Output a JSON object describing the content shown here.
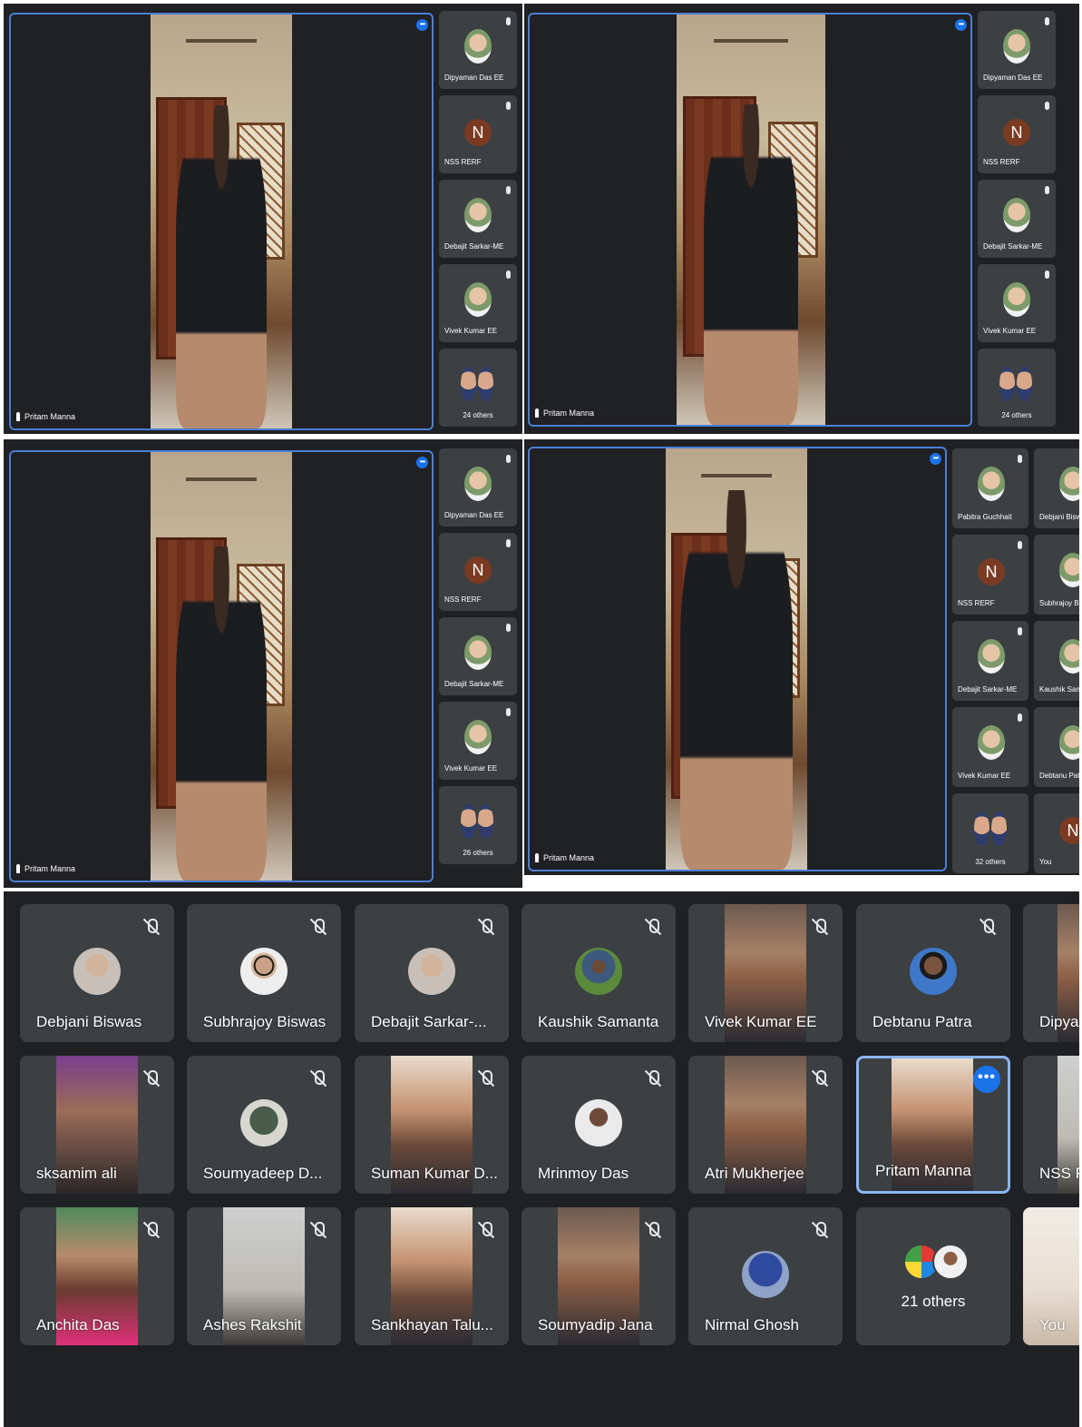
{
  "colors": {
    "meet_bg": "#202124",
    "tile_bg": "#3c4043",
    "active_border": "#4a7fd6",
    "selected_border": "#8ab4f8",
    "more_button": "#1a73e8"
  },
  "screenshots": [
    {
      "presenter": "Pritam Manna",
      "sidebar": [
        {
          "label": "Dipyaman Das EE",
          "kind": "photo"
        },
        {
          "label": "NSS RERF",
          "kind": "letter",
          "letter": "N"
        },
        {
          "label": "Debajit Sarkar-ME",
          "kind": "photo"
        },
        {
          "label": "Vivek Kumar EE",
          "kind": "photo"
        },
        {
          "label": "24 others",
          "kind": "pair"
        }
      ]
    },
    {
      "presenter": "Pritam Manna",
      "sidebar": [
        {
          "label": "Dipyaman Das EE",
          "kind": "photo"
        },
        {
          "label": "NSS RERF",
          "kind": "letter",
          "letter": "N"
        },
        {
          "label": "Debajit Sarkar-ME",
          "kind": "photo"
        },
        {
          "label": "Vivek Kumar EE",
          "kind": "photo"
        },
        {
          "label": "24 others",
          "kind": "pair"
        }
      ]
    },
    {
      "presenter": "Pritam Manna",
      "sidebar": [
        {
          "label": "Dipyaman Das EE",
          "kind": "photo"
        },
        {
          "label": "NSS RERF",
          "kind": "letter",
          "letter": "N"
        },
        {
          "label": "Debajit Sarkar-ME",
          "kind": "photo"
        },
        {
          "label": "Vivek Kumar EE",
          "kind": "photo"
        },
        {
          "label": "26 others",
          "kind": "pair"
        }
      ]
    },
    {
      "presenter": "Pritam Manna",
      "sidebar": [
        {
          "label": "Pabitra Guchhait",
          "kind": "photo"
        },
        {
          "label": "NSS RERF",
          "kind": "letter",
          "letter": "N"
        },
        {
          "label": "Debajit Sarkar-ME",
          "kind": "photo"
        },
        {
          "label": "Vivek Kumar EE",
          "kind": "photo"
        },
        {
          "label": "32 others",
          "kind": "pair"
        }
      ],
      "sidebar2": [
        {
          "label": "Debjani Biswas",
          "kind": "photo"
        },
        {
          "label": "Subhrajoy Biswas",
          "kind": "photo"
        },
        {
          "label": "Kaushik Samanta",
          "kind": "photo"
        },
        {
          "label": "Debtanu Patra",
          "kind": "photo"
        },
        {
          "label": "You",
          "kind": "letter",
          "letter": "N"
        }
      ]
    }
  ],
  "grid": {
    "row1": [
      "Debjani Biswas",
      "Subhrajoy Biswas",
      "Debajit Sarkar-...",
      "Kaushik Samanta",
      "Vivek Kumar EE",
      "Debtanu Patra",
      "Dipya"
    ],
    "row2": [
      "sksamim ali",
      "Soumyadeep D...",
      "Suman Kumar D...",
      "Mrinmoy Das",
      "Atri Mukherjee",
      "Pritam Manna",
      "NSS R"
    ],
    "row3": [
      "Anchita Das",
      "Ashes Rakshit",
      "Sankhayan Talu...",
      "Soumyadip Jana",
      "Nirmal Ghosh",
      "21 others",
      "You"
    ],
    "more_glyph": "•••"
  },
  "icons": {
    "mute": "mic-off-icon",
    "pin": "pin-icon",
    "more": "more-options-icon"
  }
}
